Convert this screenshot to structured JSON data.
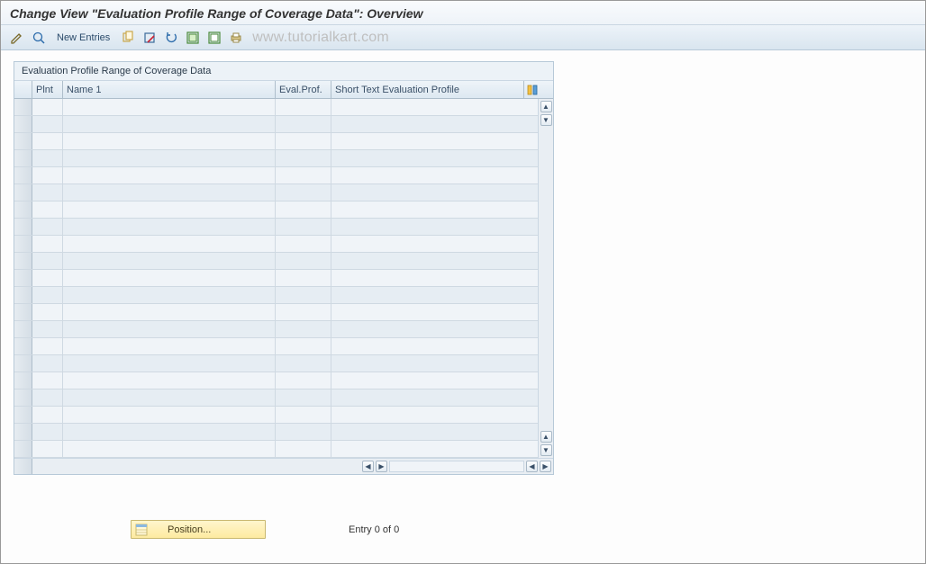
{
  "header": {
    "title": "Change View \"Evaluation Profile Range of Coverage Data\": Overview"
  },
  "toolbar": {
    "new_entries_label": "New Entries",
    "watermark": "www.tutorialkart.com"
  },
  "panel": {
    "title": "Evaluation Profile Range of Coverage Data",
    "columns": {
      "plnt": "Plnt",
      "name1": "Name 1",
      "evalprof": "Eval.Prof.",
      "shorttext": "Short Text Evaluation Profile"
    },
    "rows": [
      {
        "plnt": "",
        "name1": "",
        "evalprof": "",
        "shorttext": ""
      },
      {
        "plnt": "",
        "name1": "",
        "evalprof": "",
        "shorttext": ""
      },
      {
        "plnt": "",
        "name1": "",
        "evalprof": "",
        "shorttext": ""
      },
      {
        "plnt": "",
        "name1": "",
        "evalprof": "",
        "shorttext": ""
      },
      {
        "plnt": "",
        "name1": "",
        "evalprof": "",
        "shorttext": ""
      },
      {
        "plnt": "",
        "name1": "",
        "evalprof": "",
        "shorttext": ""
      },
      {
        "plnt": "",
        "name1": "",
        "evalprof": "",
        "shorttext": ""
      },
      {
        "plnt": "",
        "name1": "",
        "evalprof": "",
        "shorttext": ""
      },
      {
        "plnt": "",
        "name1": "",
        "evalprof": "",
        "shorttext": ""
      },
      {
        "plnt": "",
        "name1": "",
        "evalprof": "",
        "shorttext": ""
      },
      {
        "plnt": "",
        "name1": "",
        "evalprof": "",
        "shorttext": ""
      },
      {
        "plnt": "",
        "name1": "",
        "evalprof": "",
        "shorttext": ""
      },
      {
        "plnt": "",
        "name1": "",
        "evalprof": "",
        "shorttext": ""
      },
      {
        "plnt": "",
        "name1": "",
        "evalprof": "",
        "shorttext": ""
      },
      {
        "plnt": "",
        "name1": "",
        "evalprof": "",
        "shorttext": ""
      },
      {
        "plnt": "",
        "name1": "",
        "evalprof": "",
        "shorttext": ""
      },
      {
        "plnt": "",
        "name1": "",
        "evalprof": "",
        "shorttext": ""
      },
      {
        "plnt": "",
        "name1": "",
        "evalprof": "",
        "shorttext": ""
      },
      {
        "plnt": "",
        "name1": "",
        "evalprof": "",
        "shorttext": ""
      },
      {
        "plnt": "",
        "name1": "",
        "evalprof": "",
        "shorttext": ""
      },
      {
        "plnt": "",
        "name1": "",
        "evalprof": "",
        "shorttext": ""
      }
    ]
  },
  "footer": {
    "position_label": "Position...",
    "status": "Entry 0 of 0"
  }
}
